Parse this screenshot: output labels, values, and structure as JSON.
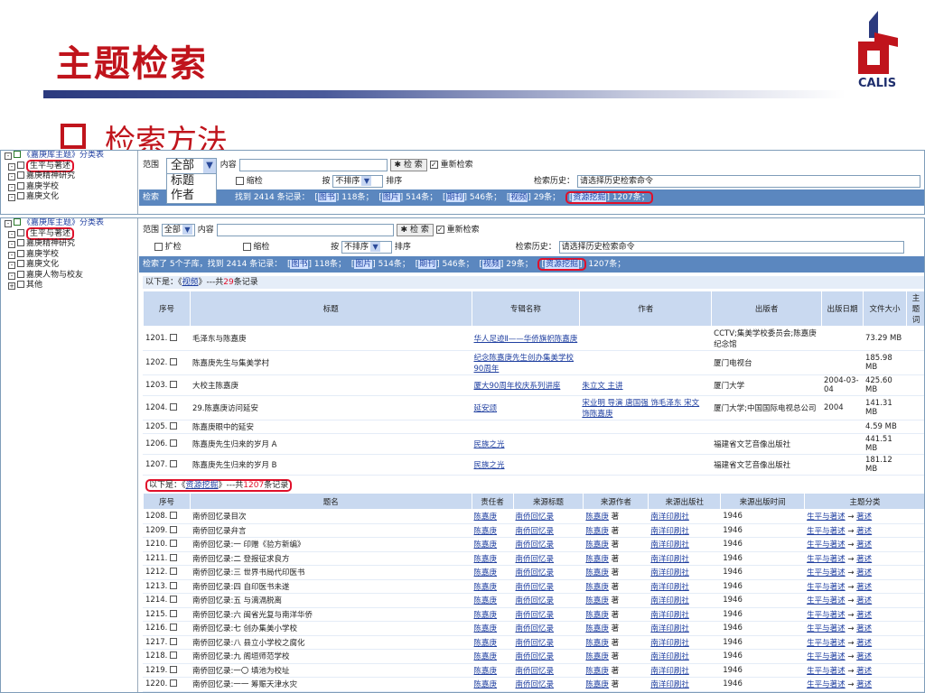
{
  "slide": {
    "title": "主题检索",
    "subtitle": "检索方法",
    "logo": "CALIS"
  },
  "tree": {
    "root": "《嘉庚库主题》分类表",
    "items": [
      "生平与著述",
      "嘉庚精神研究",
      "嘉庚学校",
      "嘉庚文化",
      "嘉庚人物与校友",
      "其他"
    ]
  },
  "form": {
    "scope_label": "范围",
    "scope_value": "全部",
    "content_label": "内容",
    "search_btn": "检 索",
    "research_label": "重新检索",
    "expand_label": "扩检",
    "narrow_label": "缩检",
    "sort_by": "按",
    "sort_value": "不排序",
    "sort_label": "排序",
    "history_label": "检索历史：",
    "history_value": "请选择历史检索命令",
    "dropdown_options": [
      "全部",
      "标题",
      "作者"
    ]
  },
  "summary1": "检索了 5个子库，找到 2414 条记录：",
  "summary1_short": "找到 2414 条记录：",
  "cats": [
    [
      "图书",
      "118条；"
    ],
    [
      "图片",
      "514条；"
    ],
    [
      "期刊",
      "546条；"
    ],
    [
      "视频",
      "29条；"
    ],
    [
      "资源挖掘",
      "1207条；"
    ]
  ],
  "video_head": "以下是：《视频》---共29条记录",
  "video_head_parts": {
    "pre": "以下是：《",
    "name": "视频",
    "mid": "》---共",
    "num": "29",
    "post": "条记录"
  },
  "video_cols": [
    "序号",
    "标题",
    "专辑名称",
    "作者",
    "出版者",
    "出版日期",
    "文件大小",
    "主题词"
  ],
  "video_rows": [
    [
      "1201.",
      "毛泽东与陈嘉庚",
      "华人足迹Ⅱ——华侨旗帜陈嘉庚",
      "",
      "CCTV;集美学校委员会;陈嘉庚纪念馆",
      "",
      "73.29 MB"
    ],
    [
      "1202.",
      "陈嘉庚先生与集美学村",
      "纪念陈嘉庚先生创办集美学校90周年",
      "",
      "厦门电视台",
      "",
      "185.98 MB"
    ],
    [
      "1203.",
      "大校主陈嘉庚",
      "厦大90周年校庆系列讲座",
      "朱立文 主讲",
      "厦门大学",
      "2004-03-04",
      "425.60 MB"
    ],
    [
      "1204.",
      "29.陈嘉庚访问延安",
      "延安颂",
      "宋业明 导演 唐国强 饰毛泽东 宋文 饰陈嘉庚",
      "厦门大学;中国国际电视总公司",
      "2004",
      "141.31 MB"
    ],
    [
      "1205.",
      "陈嘉庚眼中的延安",
      "",
      "",
      "",
      "",
      "4.59 MB"
    ],
    [
      "1206.",
      "陈嘉庚先生归来的岁月 A",
      "民族之光",
      "",
      "福建省文艺音像出版社",
      "",
      "441.51 MB"
    ],
    [
      "1207.",
      "陈嘉庚先生归来的岁月 B",
      "民族之光",
      "",
      "福建省文艺音像出版社",
      "",
      "181.12 MB"
    ]
  ],
  "mine_head_parts": {
    "pre": "以下是：《",
    "name": "资源挖掘",
    "mid": "》---共",
    "num": "1207",
    "post": "条记录"
  },
  "mine_cols": [
    "序号",
    "题名",
    "责任者",
    "来源标题",
    "来源作者",
    "来源出版社",
    "来源出版时间",
    "主题分类"
  ],
  "mine_rows": [
    [
      "1208.",
      "南侨回忆录目次"
    ],
    [
      "1209.",
      "南侨回忆录弁言"
    ],
    [
      "1210.",
      "南侨回忆录:一 印赠《验方新编》"
    ],
    [
      "1211.",
      "南侨回忆录:二 登报征求良方"
    ],
    [
      "1212.",
      "南侨回忆录:三 世界书局代印医书"
    ],
    [
      "1213.",
      "南侨回忆录:四 自印医书未遂"
    ],
    [
      "1214.",
      "南侨回忆录:五 与漓滆脱离"
    ],
    [
      "1215.",
      "南侨回忆录:六 闽省光复与南洋华侨"
    ],
    [
      "1216.",
      "南侨回忆录:七 创办集美小学校"
    ],
    [
      "1217.",
      "南侨回忆录:八 县立小学校之腐化"
    ],
    [
      "1218.",
      "南侨回忆录:九 阁垣师范学校"
    ],
    [
      "1219.",
      "南侨回忆录:一〇 填池为校址"
    ],
    [
      "1220.",
      "南侨回忆录:一一 筹赈天津水灾"
    ]
  ],
  "mine_common": {
    "author": "陈嘉庚",
    "source": "南侨回忆录",
    "src_author": "陈嘉庚",
    "src_author_suffix": "著",
    "publisher": "南洋印刷社",
    "year": "1946",
    "topic": "生平与著述",
    "arrow": "→",
    "topic2": "著述"
  }
}
